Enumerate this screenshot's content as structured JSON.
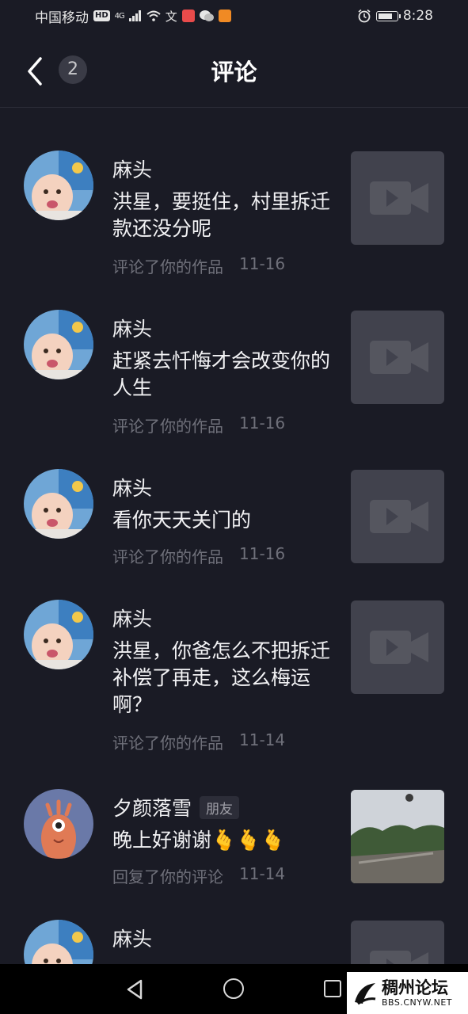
{
  "status_bar": {
    "carrier": "中国移动",
    "hd": "HD",
    "network": "4G",
    "time": "8:28",
    "battery_level": 0.85
  },
  "header": {
    "back_icon": "chevron-left-icon",
    "unread_count": "2",
    "title": "评论"
  },
  "comments": [
    {
      "name": "麻头",
      "friend_tag": "",
      "text": "洪星，要挺住，村里拆迁款还没分呢",
      "action": "评论了你的作品",
      "date": "11-16",
      "thumb": "video-placeholder"
    },
    {
      "name": "麻头",
      "friend_tag": "",
      "text": "赶紧去忏悔才会改变你的人生",
      "action": "评论了你的作品",
      "date": "11-16",
      "thumb": "video-placeholder"
    },
    {
      "name": "麻头",
      "friend_tag": "",
      "text": "看你天天关门的",
      "action": "评论了你的作品",
      "date": "11-16",
      "thumb": "video-placeholder"
    },
    {
      "name": "麻头",
      "friend_tag": "",
      "text": "洪星，你爸怎么不把拆迁补偿了再走，这么梅运啊？",
      "action": "评论了你的作品",
      "date": "11-14",
      "thumb": "video-placeholder"
    },
    {
      "name": "夕颜落雪",
      "friend_tag": "朋友",
      "text": "晚上好谢谢🫰🫰🫰",
      "action": "回复了你的评论",
      "date": "11-14",
      "thumb": "landscape-photo"
    },
    {
      "name": "麻头",
      "friend_tag": "",
      "text": "",
      "action": "",
      "date": "",
      "thumb": "video-placeholder"
    }
  ],
  "watermark": {
    "title": "稠州论坛",
    "subtitle": "BBS.CNYW.NET"
  },
  "colors": {
    "background": "#1a1b25",
    "meta_text": "#6f707a",
    "thumb_placeholder": "#41424d"
  }
}
